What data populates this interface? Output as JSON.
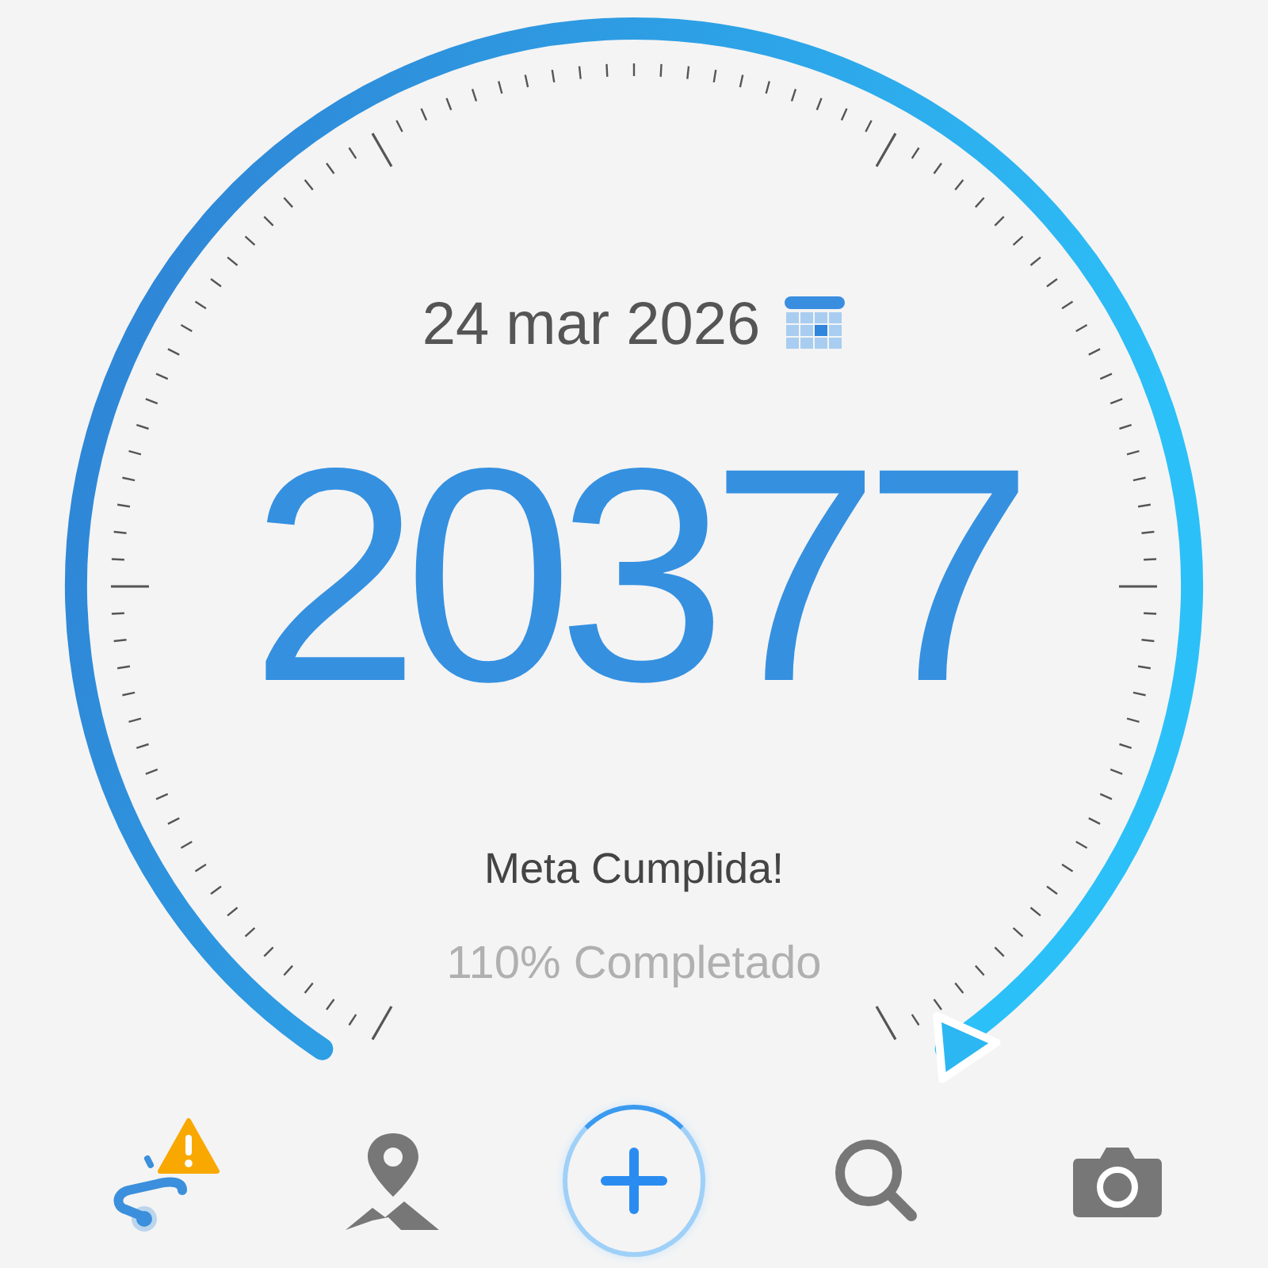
{
  "gauge": {
    "date": "24 mar 2026",
    "steps": "20377",
    "status": "Meta Cumplida!",
    "progress": "110% Completado"
  },
  "nav": [
    {
      "kind": "route",
      "selected": true,
      "alert": true
    },
    {
      "kind": "place",
      "selected": false,
      "alert": false
    },
    {
      "kind": "add",
      "selected": false,
      "alert": false
    },
    {
      "kind": "search",
      "selected": false,
      "alert": false
    },
    {
      "kind": "camera",
      "selected": false,
      "alert": false
    }
  ]
}
